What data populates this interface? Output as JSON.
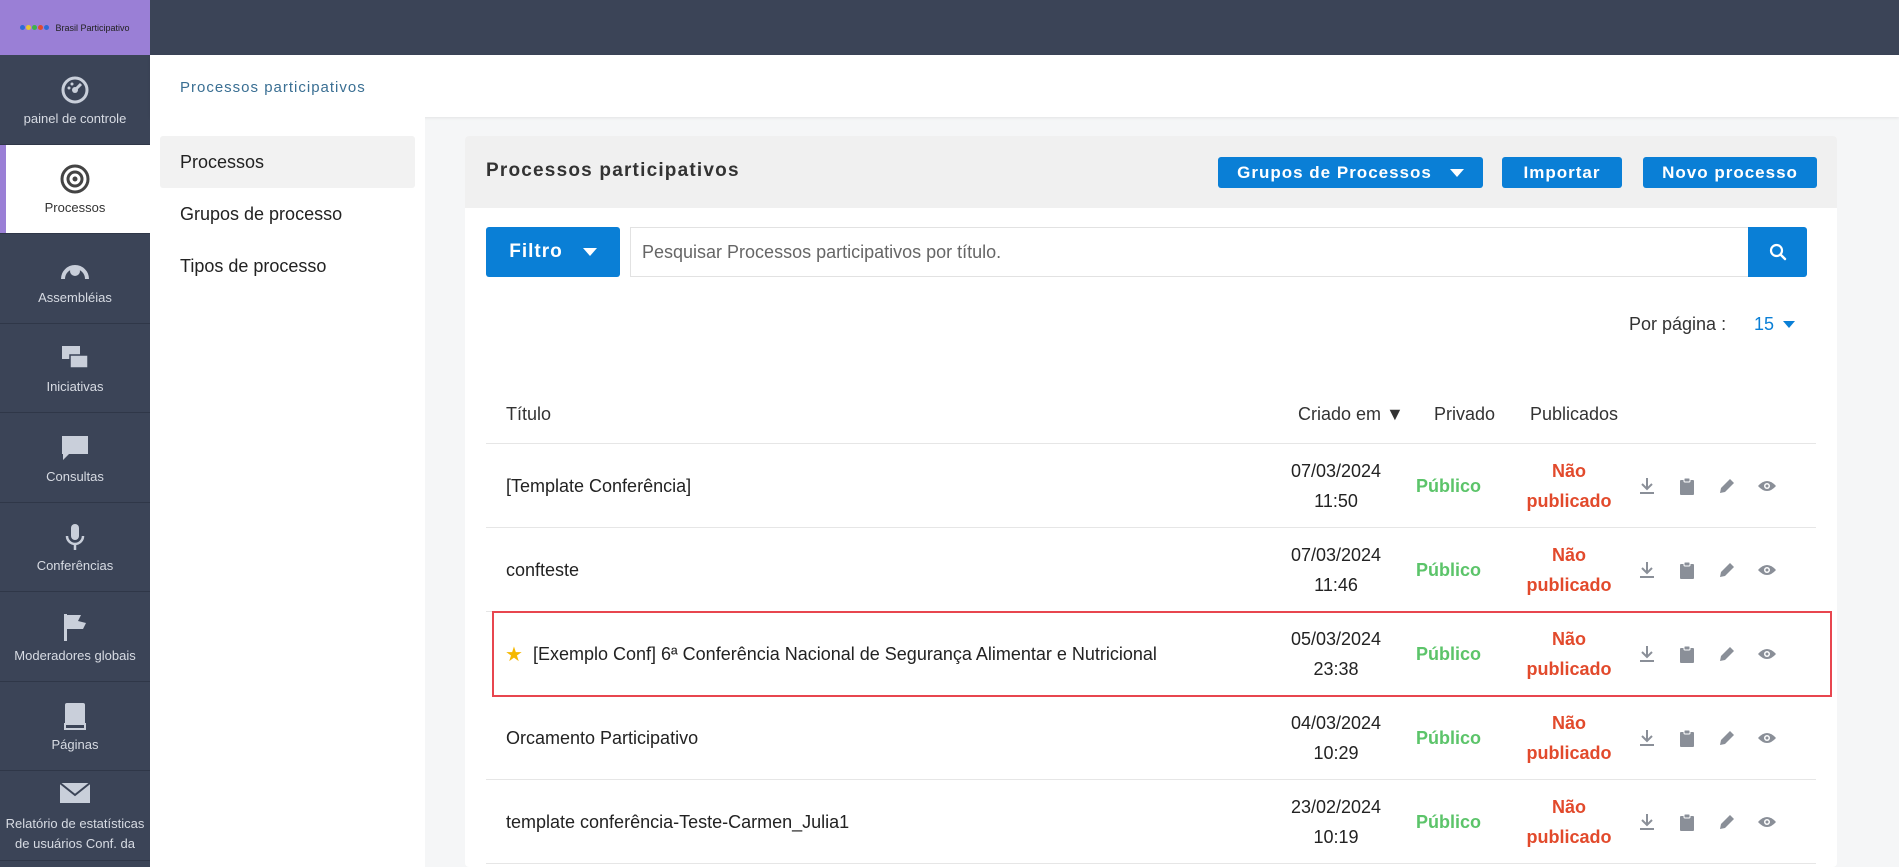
{
  "brand": {
    "name": "Brasil Participativo"
  },
  "sidebar": {
    "items": [
      {
        "label": "painel de controle",
        "icon": "dashboard-icon"
      },
      {
        "label": "Processos",
        "icon": "target-icon",
        "active": true
      },
      {
        "label": "Assembléias",
        "icon": "assembly-icon"
      },
      {
        "label": "Iniciativas",
        "icon": "initiatives-icon"
      },
      {
        "label": "Consultas",
        "icon": "consultations-icon"
      },
      {
        "label": "Conferências",
        "icon": "microphone-icon"
      },
      {
        "label": "Moderadores globais",
        "icon": "flag-icon"
      },
      {
        "label": "Páginas",
        "icon": "book-icon"
      },
      {
        "label": "Relatório de estatísticas de usuários Conf. da",
        "icon": "envelope-icon"
      }
    ]
  },
  "breadcrumb": "Processos participativos",
  "subnav": {
    "items": [
      {
        "label": "Processos",
        "active": true
      },
      {
        "label": "Grupos de processo"
      },
      {
        "label": "Tipos de processo"
      }
    ]
  },
  "card": {
    "title": "Processos participativos",
    "buttons": {
      "groups": "Grupos de Processos",
      "import": "Importar",
      "new": "Novo processo"
    },
    "filter_label": "Filtro",
    "search_placeholder": "Pesquisar Processos participativos por título.",
    "per_page_label": "Por página :",
    "per_page_value": "15"
  },
  "table": {
    "headers": {
      "title": "Título",
      "created": "Criado em ▼",
      "private": "Privado",
      "published": "Publicados"
    },
    "rows": [
      {
        "title": "[Template Conferência]",
        "date": "07/03/2024",
        "time": "11:50",
        "privacy": "Público",
        "pub1": "Não",
        "pub2": "publicado",
        "starred": false
      },
      {
        "title": "confteste",
        "date": "07/03/2024",
        "time": "11:46",
        "privacy": "Público",
        "pub1": "Não",
        "pub2": "publicado",
        "starred": false
      },
      {
        "title": "[Exemplo Conf] 6ª Conferência Nacional de Segurança Alimentar e Nutricional",
        "date": "05/03/2024",
        "time": "23:38",
        "privacy": "Público",
        "pub1": "Não",
        "pub2": "publicado",
        "starred": true
      },
      {
        "title": "Orcamento Participativo",
        "date": "04/03/2024",
        "time": "10:29",
        "privacy": "Público",
        "pub1": "Não",
        "pub2": "publicado",
        "starred": false
      },
      {
        "title": "template conferência-Teste-Carmen_Julia1",
        "date": "23/02/2024",
        "time": "10:19",
        "privacy": "Público",
        "pub1": "Não",
        "pub2": "publicado",
        "starred": false
      }
    ],
    "row_actions": [
      "download-icon",
      "clipboard-icon",
      "pencil-icon",
      "eye-icon"
    ]
  },
  "colors": {
    "topbar": "#3b4457",
    "accent": "#0a7fd6",
    "brand": "#9a7fd6",
    "public": "#5cc46a",
    "unpublished": "#e24a2c",
    "highlight": "#e8464f"
  }
}
